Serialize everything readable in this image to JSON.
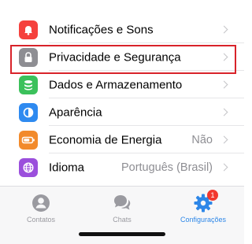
{
  "settings": {
    "items": [
      {
        "label": "Notificações e Sons",
        "value": "",
        "icon": "notification-icon",
        "color": "#f5413d"
      },
      {
        "label": "Privacidade e Segurança",
        "value": "",
        "icon": "lock-icon",
        "color": "#8e8e93"
      },
      {
        "label": "Dados e Armazenamento",
        "value": "",
        "icon": "database-icon",
        "color": "#3bc15b"
      },
      {
        "label": "Aparência",
        "value": "",
        "icon": "appearance-icon",
        "color": "#2e8af0"
      },
      {
        "label": "Economia de Energia",
        "value": "Não",
        "icon": "battery-icon",
        "color": "#f28a2b"
      },
      {
        "label": "Idioma",
        "value": "Português (Brasil)",
        "icon": "globe-icon",
        "color": "#9b4fdc"
      }
    ],
    "highlight_color": "#d8232a"
  },
  "tabbar": {
    "tabs": [
      {
        "label": "Contatos",
        "icon": "person-icon",
        "active": false
      },
      {
        "label": "Chats",
        "icon": "chat-bubbles-icon",
        "active": false
      },
      {
        "label": "Configurações",
        "icon": "gear-icon",
        "active": true,
        "badge": "1"
      }
    ],
    "active_color": "#2e87e8",
    "inactive_color": "#9a9aa0"
  }
}
